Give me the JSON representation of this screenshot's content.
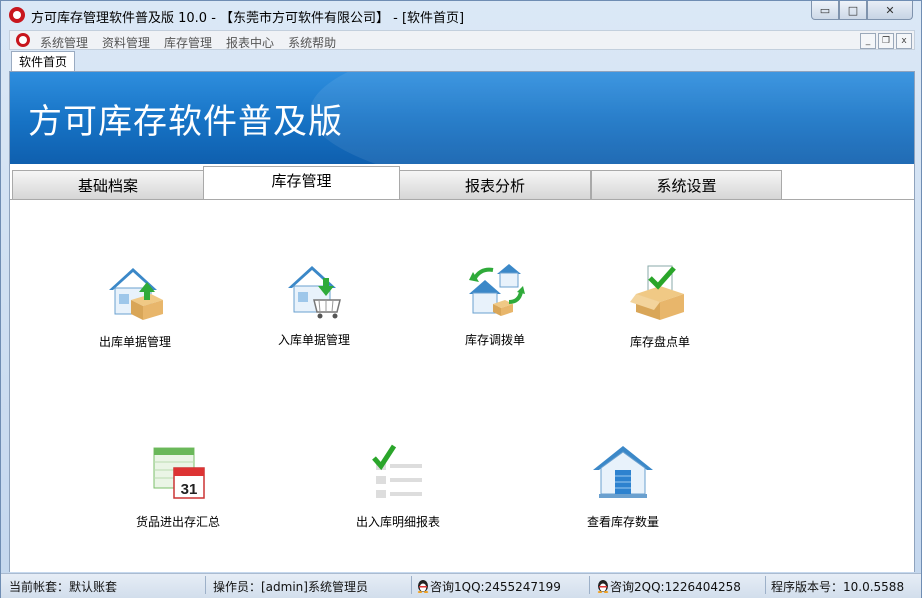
{
  "window": {
    "title": "方可库存管理软件普及版 10.0 - 【东莞市方可软件有限公司】 - [软件首页]",
    "min_glyph": "▭",
    "max_glyph": "□",
    "close_glyph": "✕"
  },
  "menubar": {
    "items": [
      "系统管理",
      "资料管理",
      "库存管理",
      "报表中心",
      "系统帮助"
    ],
    "mdi_min": "_",
    "mdi_restore": "❐",
    "mdi_close": "x"
  },
  "doc_tab": "软件首页",
  "banner": {
    "title": "方可库存软件普及版"
  },
  "tabs": [
    "基础档案",
    "库存管理",
    "报表分析",
    "系统设置"
  ],
  "active_tab": "库存管理",
  "panel": {
    "items": [
      {
        "label": "出库单据管理",
        "icon": "house-box-out-icon"
      },
      {
        "label": "入库单据管理",
        "icon": "house-cart-in-icon"
      },
      {
        "label": "库存调拨单",
        "icon": "transfer-houses-icon"
      },
      {
        "label": "库存盘点单",
        "icon": "box-check-icon"
      },
      {
        "label": "货品进出存汇总",
        "icon": "calendar-31-icon"
      },
      {
        "label": "出入库明细报表",
        "icon": "checklist-icon"
      },
      {
        "label": "查看库存数量",
        "icon": "warehouse-icon"
      }
    ],
    "calendar_day": "31"
  },
  "statusbar": {
    "account": "当前帐套：默认账套",
    "operator": "操作员：[admin]系统管理员",
    "qq1": "咨询1QQ:2455247199",
    "qq2": "咨询2QQ:1226404258",
    "version": "程序版本号：10.0.5588"
  },
  "colors": {
    "banner": "#1a76c8",
    "title_red": "#c8161d",
    "check_green": "#2aa52a"
  }
}
